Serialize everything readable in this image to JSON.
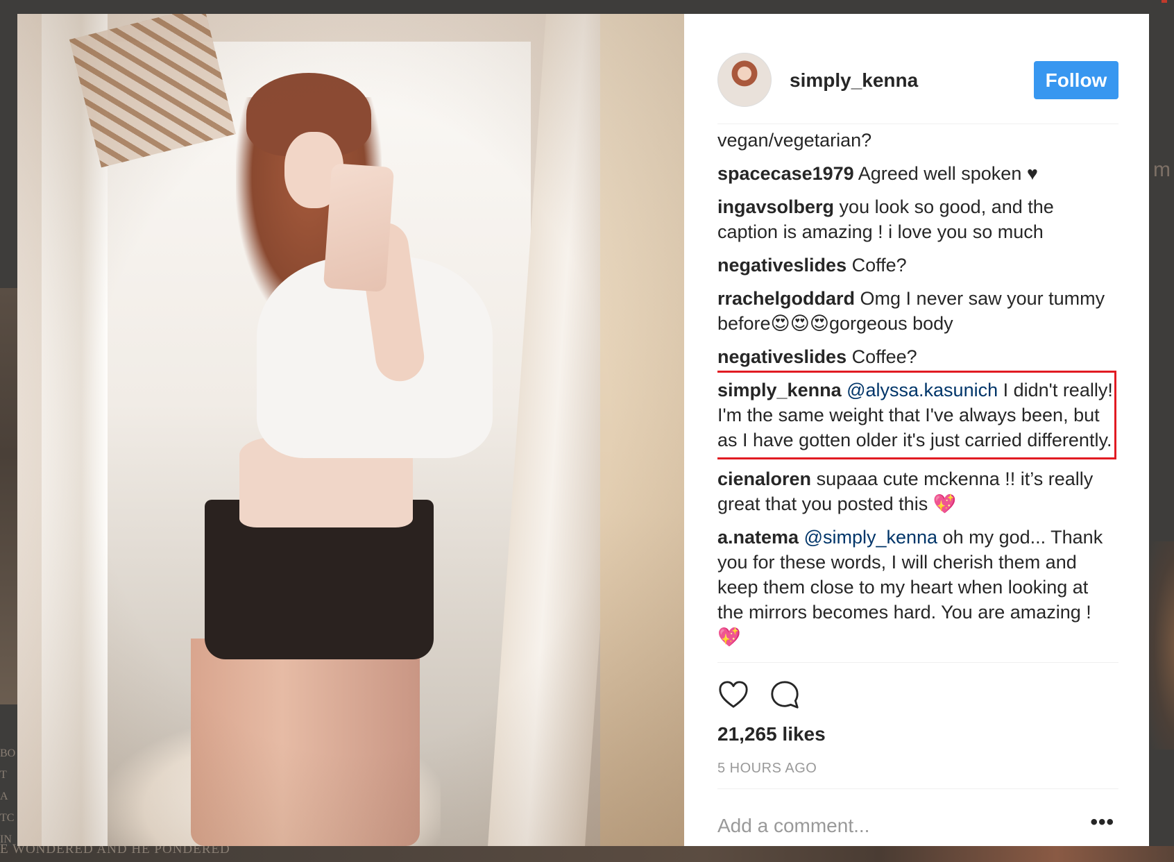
{
  "background": {
    "bottom_text": "E WONDERED AND HE PONDERED",
    "left_letters": [
      "BO",
      "T A",
      "TC",
      "IN"
    ],
    "right_fragment": "m"
  },
  "post": {
    "username": "simply_kenna",
    "follow_label": "Follow",
    "likes": "21,265 likes",
    "timestamp": "5 HOURS AGO",
    "add_comment_placeholder": "Add a comment...",
    "more_label": "•••"
  },
  "comments": [
    {
      "user": "",
      "mention": "",
      "text": "vegan/vegetarian?"
    },
    {
      "user": "spacecase1979",
      "mention": "",
      "text": " Agreed well spoken ♥"
    },
    {
      "user": "ingavsolberg",
      "mention": "",
      "text": " you look so good, and the caption is amazing ! i love you so much"
    },
    {
      "user": "negativeslides",
      "mention": "",
      "text": " Coffe?"
    },
    {
      "user": "rrachelgoddard",
      "mention": "",
      "text": " Omg I never saw your tummy before😍😍😍gorgeous body"
    },
    {
      "user": "negativeslides",
      "mention": "",
      "text": " Coffee?"
    },
    {
      "user": "simply_kenna",
      "mention": " @alyssa.kasunich",
      "text": " I didn't really! I'm the same weight that I've always been, but as I have gotten older it's just carried differently."
    },
    {
      "user": "cienaloren",
      "mention": "",
      "text": " supaaa cute mckenna !! it’s really great that you posted this 💖"
    },
    {
      "user": "a.natema",
      "mention": " @simply_kenna",
      "text": " oh my god... Thank you for these words, I will cherish them and keep them close to my heart when looking at the mirrors becomes hard. You are amazing ! 💖"
    }
  ],
  "colors": {
    "follow_button": "#3897f0",
    "highlight_border": "#e11b22",
    "mention": "#003569"
  },
  "icons": [
    "heart-icon",
    "comment-icon",
    "more-icon"
  ]
}
